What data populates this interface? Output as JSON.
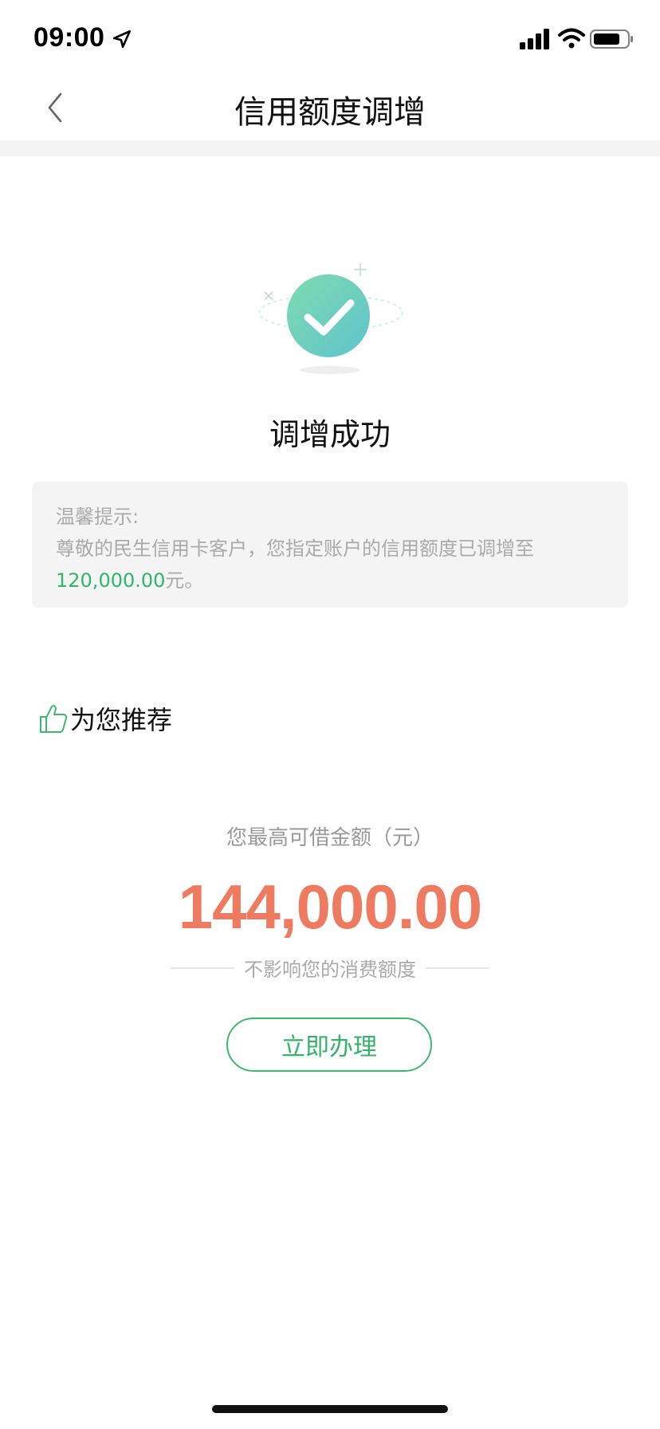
{
  "status_bar": {
    "time": "09:00",
    "icons": [
      "location-arrow-icon",
      "cellular-signal-icon",
      "wifi-icon",
      "battery-icon"
    ]
  },
  "nav": {
    "title": "信用额度调增",
    "back_icon": "chevron-left-icon"
  },
  "success": {
    "icon": "check-circle-icon",
    "title": "调增成功"
  },
  "tip": {
    "heading": "温馨提示:",
    "message": "尊敬的民生信用卡客户，您指定账户的信用额度已调增至",
    "amount": "120,000.00",
    "suffix": "元。"
  },
  "recommend": {
    "icon": "thumbs-up-icon",
    "title": "为您推荐",
    "loan_label": "您最高可借金额（元）",
    "loan_amount": "144,000.00",
    "note": "不影响您的消费额度",
    "apply_label": "立即办理"
  },
  "colors": {
    "accent_green": "#35b36a",
    "amount_orange": "#ee7b5f",
    "success_teal": "#6fd1be"
  }
}
